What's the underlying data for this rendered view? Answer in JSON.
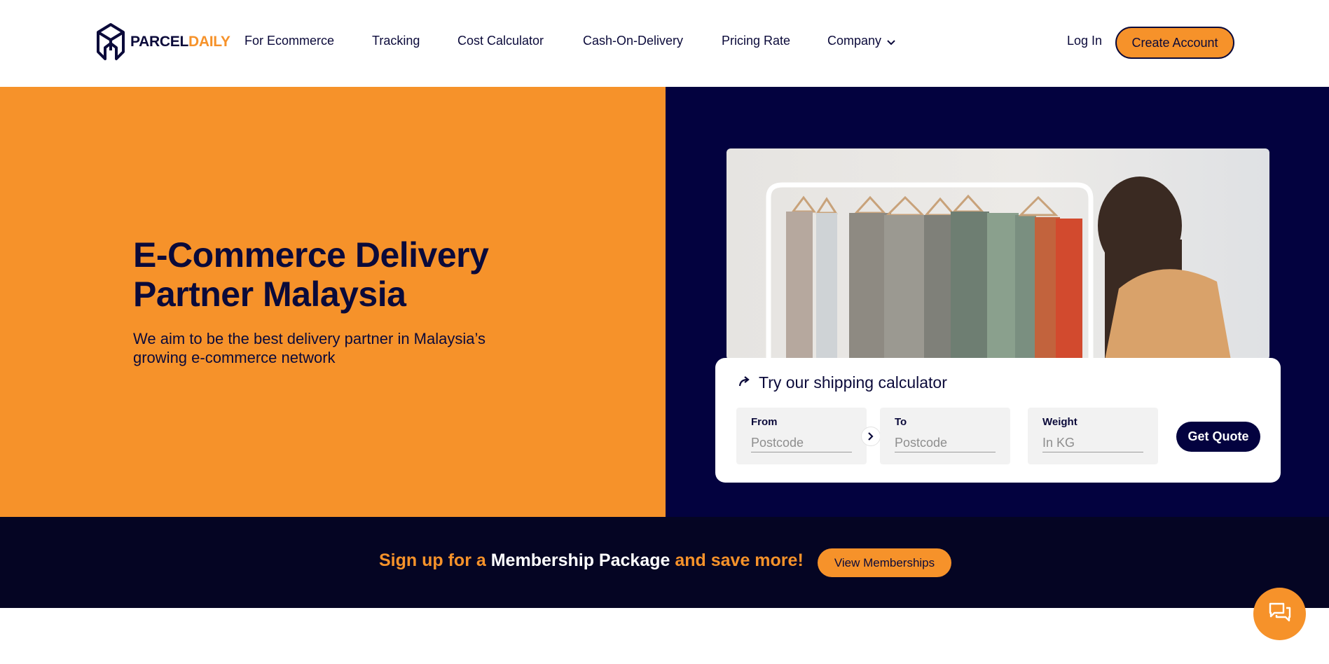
{
  "brand": {
    "part1": "PARCEL",
    "part2": "DAILY"
  },
  "nav": {
    "items": [
      {
        "label": "For Ecommerce"
      },
      {
        "label": "Tracking"
      },
      {
        "label": "Cost Calculator"
      },
      {
        "label": "Cash-On-Delivery"
      },
      {
        "label": "Pricing Rate"
      },
      {
        "label": "Company"
      }
    ],
    "login": "Log In",
    "create_account": "Create Account"
  },
  "hero": {
    "title_line1": "E-Commerce Delivery",
    "title_line2": "Partner Malaysia",
    "subtitle": "We aim to be the best delivery partner in Malaysia’s growing e-commerce network"
  },
  "calculator": {
    "title": "Try our shipping calculator",
    "from_label": "From",
    "from_placeholder": "Postcode",
    "to_label": "To",
    "to_placeholder": "Postcode",
    "weight_label": "Weight",
    "weight_placeholder": "In KG",
    "button": "Get Quote"
  },
  "membership": {
    "text1": "Sign up for a",
    "text2": "Membership Package",
    "text3": "and save more!",
    "button": "View Memberships"
  },
  "icons": {
    "logo": "parceldaily-logo-icon",
    "company_dropdown": "chevron-down-icon",
    "calculator": "share-arrow-icon",
    "from_to": "chevron-right-icon",
    "chat": "chat-bubbles-icon"
  },
  "colors": {
    "orange": "#f6922a",
    "navy": "#03023f",
    "band": "#050523",
    "text": "#0b0a3a"
  }
}
